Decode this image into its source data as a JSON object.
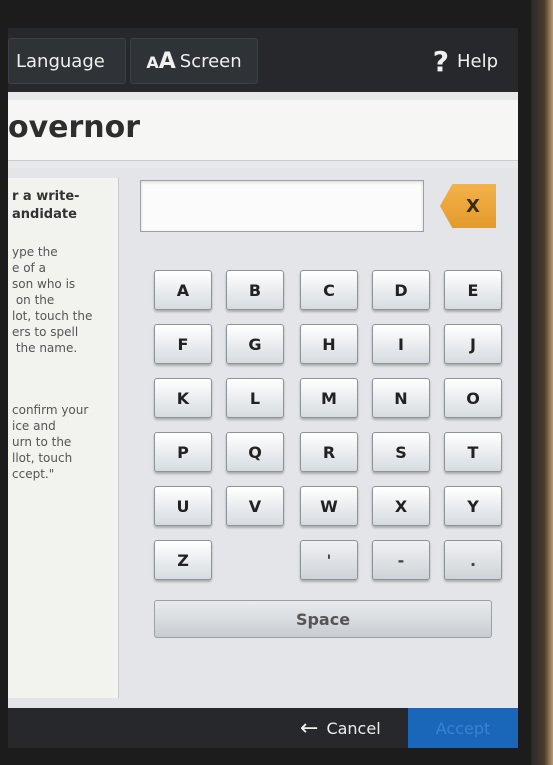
{
  "topbar": {
    "language_label": "Language",
    "screen_prefix": "A",
    "screen_prefix_big": "A",
    "screen_label": "Screen",
    "help_mark": "?",
    "help_label": "Help"
  },
  "contest": {
    "title": "overnor"
  },
  "instructions": {
    "heading": "r a write-\nandidate",
    "body1": "ype the\ne of a\nson who is\n on the\nlot, touch the\ners to spell\n the name.",
    "body2": "confirm your\nice and\nurn to the\nllot, touch\nccept.\""
  },
  "keyboard": {
    "clear_label": "X",
    "rows": [
      [
        "A",
        "B",
        "C",
        "D",
        "E"
      ],
      [
        "F",
        "G",
        "H",
        "I",
        "J"
      ],
      [
        "K",
        "L",
        "M",
        "N",
        "O"
      ],
      [
        "P",
        "Q",
        "R",
        "S",
        "T"
      ],
      [
        "U",
        "V",
        "W",
        "X",
        "Y"
      ],
      [
        "Z",
        "",
        "'",
        "-",
        "."
      ]
    ],
    "space_label": "Space"
  },
  "bottombar": {
    "cancel_arrow": "←",
    "cancel_label": "Cancel",
    "accept_label": "Accept"
  },
  "colors": {
    "accent_orange": "#f0a63c",
    "accept_blue": "#1a66b8",
    "topbar_bg": "#26282b"
  },
  "icons": {
    "help": "question-mark-icon",
    "cancel": "left-arrow-icon",
    "clear": "backspace-x-icon"
  }
}
